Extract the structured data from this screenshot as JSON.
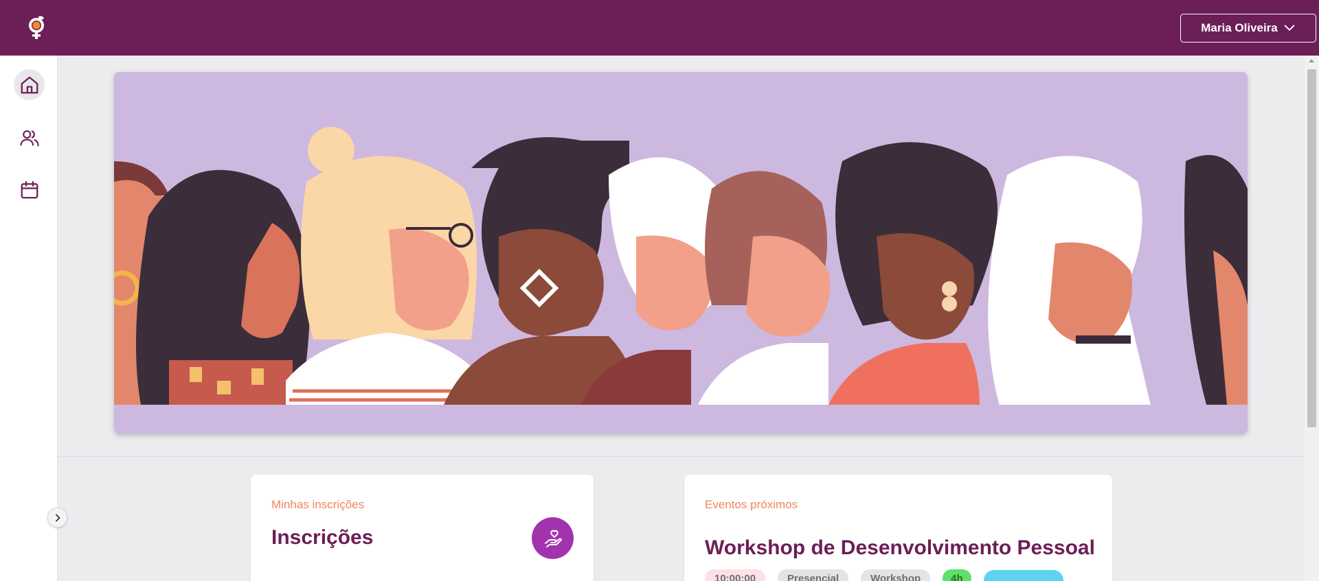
{
  "header": {
    "user_name": "Maria Oliveira",
    "logo_icon": "women-symbol-logo-icon",
    "chevron_icon": "chevron-down-icon",
    "background": "#6c1e56"
  },
  "sidebar": {
    "items": [
      {
        "name": "home",
        "icon": "home-icon",
        "active": true
      },
      {
        "name": "users",
        "icon": "users-icon",
        "active": false
      },
      {
        "name": "calendar",
        "icon": "calendar-icon",
        "active": false
      }
    ],
    "collapse_icon": "chevron-right-icon"
  },
  "banner": {
    "illustration": "women-profiles-illustration",
    "background": "#cdb8df"
  },
  "cards": {
    "registrations": {
      "label": "Minhas inscrições",
      "title": "Inscrições",
      "icon": "heart-hand-icon"
    },
    "events": {
      "label": "Eventos próximos",
      "title": "Workshop de Desenvolvimento Pessoal",
      "tags": {
        "time": "10:00:00",
        "mode": "Presencial",
        "type": "Workshop",
        "duration": "4h"
      }
    }
  },
  "colors": {
    "accent": "#6c1e56",
    "label": "#f2845c",
    "icon_button": "#a333ac"
  }
}
